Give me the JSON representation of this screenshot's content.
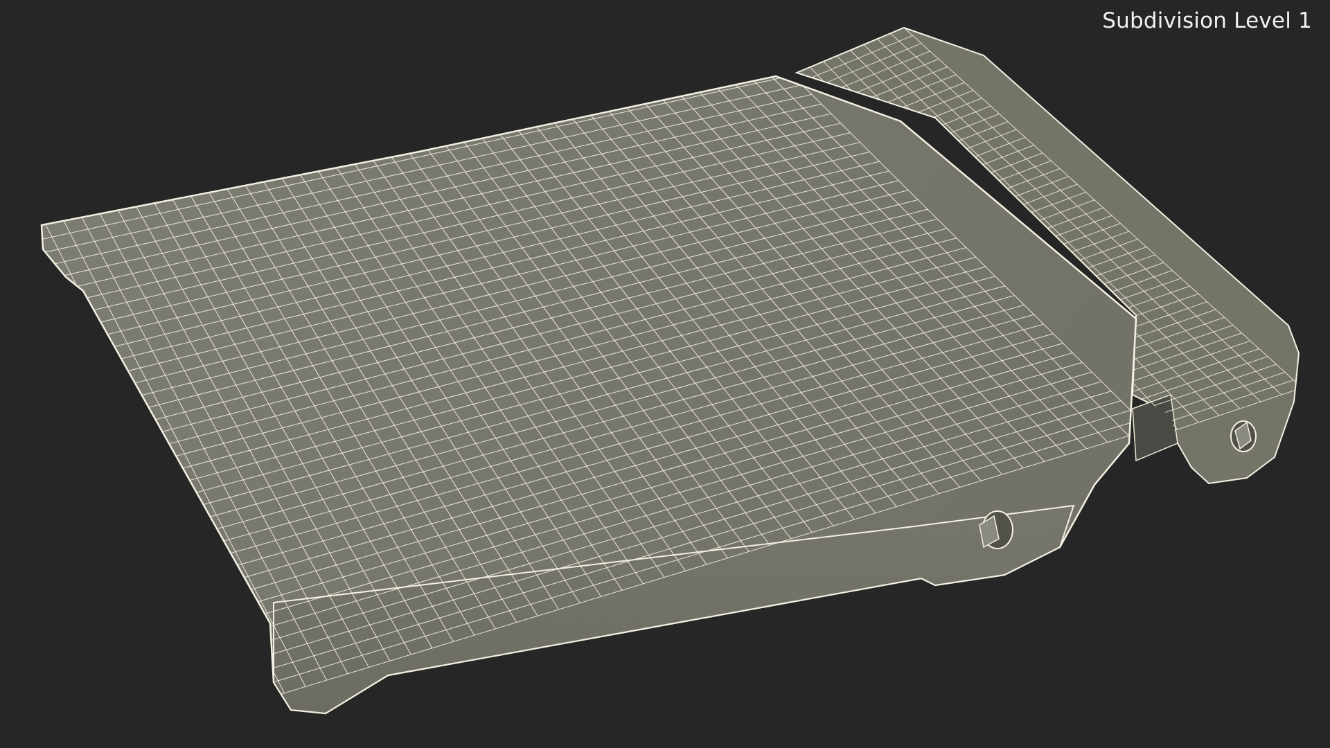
{
  "viewport": {
    "label": "Subdivision Level 1",
    "background_color": "#262626",
    "surface_color": "#7a7a70",
    "wire_color": "#f4f1e2"
  }
}
